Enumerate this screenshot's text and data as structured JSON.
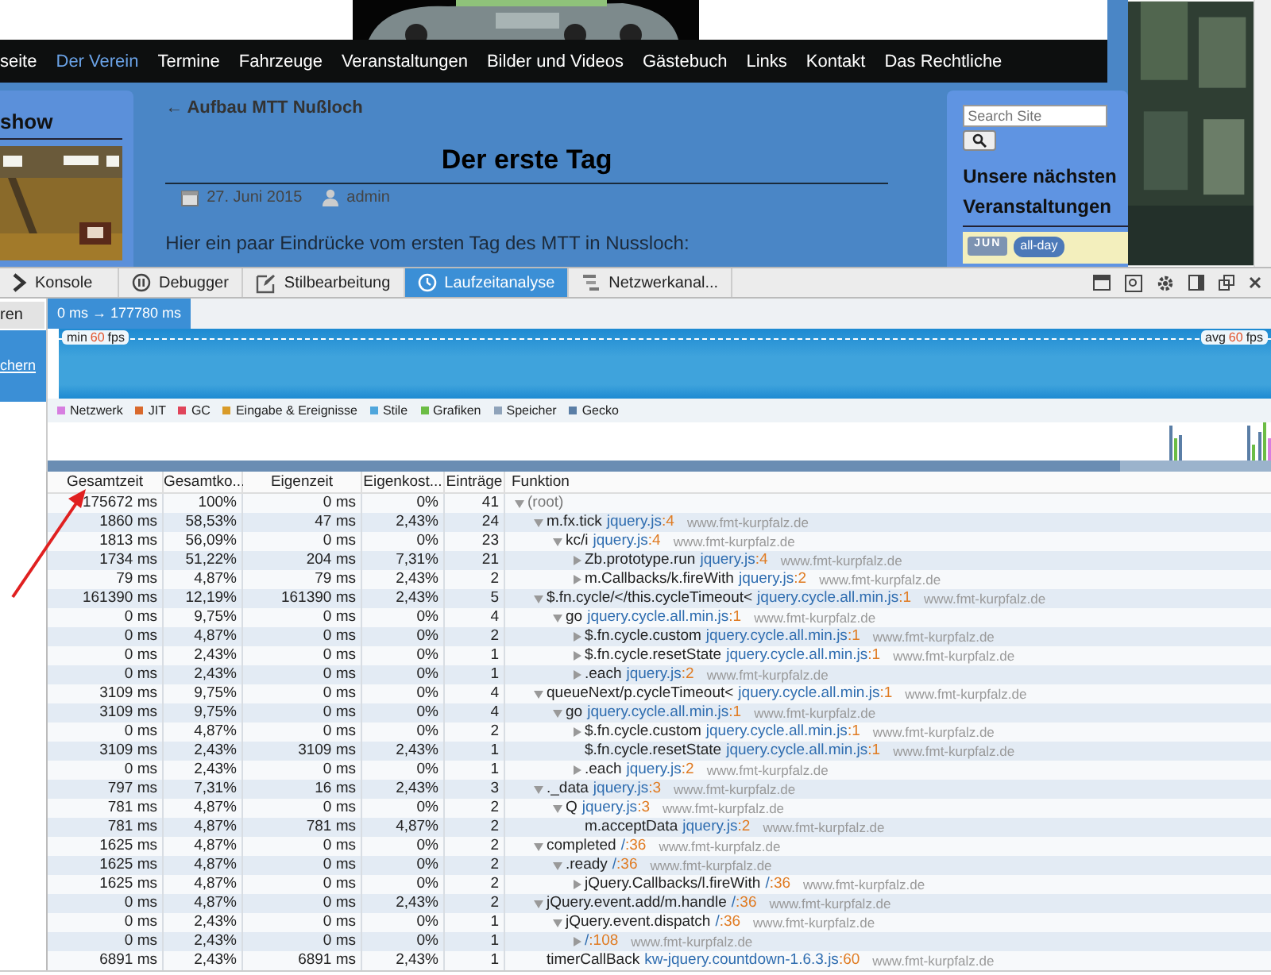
{
  "site": {
    "nav": [
      {
        "label": "seite",
        "selected": false
      },
      {
        "label": "Der Verein",
        "selected": true
      },
      {
        "label": "Termine",
        "selected": false
      },
      {
        "label": "Fahrzeuge",
        "selected": false
      },
      {
        "label": "Veranstaltungen",
        "selected": false
      },
      {
        "label": "Bilder und Videos",
        "selected": false
      },
      {
        "label": "Gästebuch",
        "selected": false
      },
      {
        "label": "Links",
        "selected": false
      },
      {
        "label": "Kontakt",
        "selected": false
      },
      {
        "label": "Das Rechtliche",
        "selected": false
      }
    ],
    "slideshow_heading": "show",
    "back_link": "← Aufbau MTT Nußloch",
    "post_title": "Der erste Tag",
    "date": "27. Juni 2015",
    "author": "admin",
    "excerpt": "Hier ein paar Eindrücke vom ersten Tag des MTT in Nussloch:",
    "search": {
      "placeholder": "Search Site"
    },
    "events_heading": "Unsere nächsten Veranstaltungen",
    "event_month": "JUN",
    "event_badge": "all-day"
  },
  "devtools": {
    "tabs": [
      {
        "label": "Konsole",
        "selected": false
      },
      {
        "label": "Debugger",
        "selected": false
      },
      {
        "label": "Stilbearbeitung",
        "selected": false
      },
      {
        "label": "Laufzeitanalyse",
        "selected": true
      },
      {
        "label": "Netzwerkanal...",
        "selected": false
      }
    ],
    "sidebar_button": "ren",
    "sidebar_link": "chern",
    "time_range": "0 ms → 177780 ms",
    "fps_min": {
      "label": "min",
      "value": "60",
      "unit": "fps"
    },
    "fps_avg": {
      "label": "avg",
      "value": "60",
      "unit": "fps"
    },
    "legend": [
      {
        "label": "Netzwerk",
        "color": "#d77ee0"
      },
      {
        "label": "JIT",
        "color": "#d9692c"
      },
      {
        "label": "GC",
        "color": "#e0445a"
      },
      {
        "label": "Eingabe & Ereignisse",
        "color": "#d99b28"
      },
      {
        "label": "Stile",
        "color": "#4fa6dc"
      },
      {
        "label": "Grafiken",
        "color": "#6cbd45"
      },
      {
        "label": "Speicher",
        "color": "#8fa3ba"
      },
      {
        "label": "Gecko",
        "color": "#5a7ea6"
      }
    ]
  },
  "table": {
    "columns": [
      "Gesamtzeit",
      "Gesamtko...",
      "Eigenzeit",
      "Eigenkost...",
      "Einträge",
      "Funktion"
    ],
    "rows": [
      {
        "total": "175672 ms",
        "total_pct": "100%",
        "self": "0 ms",
        "self_pct": "0%",
        "entries": "41",
        "function": "(root)",
        "kind": "node",
        "expanded": true,
        "children": [
          {
            "total": "1860 ms",
            "total_pct": "58,53%",
            "self": "47 ms",
            "self_pct": "2,43%",
            "entries": "24",
            "function": "m.fx.tick",
            "file": "jquery.js",
            "line": ":4",
            "host": "www.fmt-kurpfalz.de",
            "kind": "node",
            "expanded": true,
            "children": [
              {
                "total": "1813 ms",
                "total_pct": "56,09%",
                "self": "0 ms",
                "self_pct": "0%",
                "entries": "23",
                "function": "kc/i",
                "file": "jquery.js",
                "line": ":4",
                "host": "www.fmt-kurpfalz.de",
                "kind": "node",
                "expanded": true,
                "children": [
                  {
                    "total": "1734 ms",
                    "total_pct": "51,22%",
                    "self": "204 ms",
                    "self_pct": "7,31%",
                    "entries": "21",
                    "function": "Zb.prototype.run",
                    "file": "jquery.js",
                    "line": ":4",
                    "host": "www.fmt-kurpfalz.de",
                    "kind": "node",
                    "expanded": false
                  },
                  {
                    "total": "79 ms",
                    "total_pct": "4,87%",
                    "self": "79 ms",
                    "self_pct": "2,43%",
                    "entries": "2",
                    "function": "m.Callbacks/k.fireWith",
                    "file": "jquery.js",
                    "line": ":2",
                    "host": "www.fmt-kurpfalz.de",
                    "kind": "node",
                    "expanded": false
                  }
                ]
              }
            ]
          },
          {
            "total": "161390 ms",
            "total_pct": "12,19%",
            "self": "161390 ms",
            "self_pct": "2,43%",
            "entries": "5",
            "function": "$.fn.cycle/</this.cycleTimeout<",
            "file": "jquery.cycle.all.min.js",
            "line": ":1",
            "host": "www.fmt-kurpfalz.de",
            "kind": "node",
            "expanded": true,
            "children": [
              {
                "total": "0 ms",
                "total_pct": "9,75%",
                "self": "0 ms",
                "self_pct": "0%",
                "entries": "4",
                "function": "go",
                "file": "jquery.cycle.all.min.js",
                "line": ":1",
                "host": "www.fmt-kurpfalz.de",
                "kind": "node",
                "expanded": true,
                "children": [
                  {
                    "total": "0 ms",
                    "total_pct": "4,87%",
                    "self": "0 ms",
                    "self_pct": "0%",
                    "entries": "2",
                    "function": "$.fn.cycle.custom",
                    "file": "jquery.cycle.all.min.js",
                    "line": ":1",
                    "host": "www.fmt-kurpfalz.de",
                    "kind": "node",
                    "expanded": false
                  },
                  {
                    "total": "0 ms",
                    "total_pct": "2,43%",
                    "self": "0 ms",
                    "self_pct": "0%",
                    "entries": "1",
                    "function": "$.fn.cycle.resetState",
                    "file": "jquery.cycle.all.min.js",
                    "line": ":1",
                    "host": "www.fmt-kurpfalz.de",
                    "kind": "node",
                    "expanded": false
                  },
                  {
                    "total": "0 ms",
                    "total_pct": "2,43%",
                    "self": "0 ms",
                    "self_pct": "0%",
                    "entries": "1",
                    "function": ".each",
                    "file": "jquery.js",
                    "line": ":2",
                    "host": "www.fmt-kurpfalz.de",
                    "kind": "node",
                    "expanded": false
                  }
                ]
              }
            ]
          },
          {
            "total": "3109 ms",
            "total_pct": "9,75%",
            "self": "0 ms",
            "self_pct": "0%",
            "entries": "4",
            "function": "queueNext/p.cycleTimeout<",
            "file": "jquery.cycle.all.min.js",
            "line": ":1",
            "host": "www.fmt-kurpfalz.de",
            "kind": "node",
            "expanded": true,
            "children": [
              {
                "total": "3109 ms",
                "total_pct": "9,75%",
                "self": "0 ms",
                "self_pct": "0%",
                "entries": "4",
                "function": "go",
                "file": "jquery.cycle.all.min.js",
                "line": ":1",
                "host": "www.fmt-kurpfalz.de",
                "kind": "node",
                "expanded": true,
                "children": [
                  {
                    "total": "0 ms",
                    "total_pct": "4,87%",
                    "self": "0 ms",
                    "self_pct": "0%",
                    "entries": "2",
                    "function": "$.fn.cycle.custom",
                    "file": "jquery.cycle.all.min.js",
                    "line": ":1",
                    "host": "www.fmt-kurpfalz.de",
                    "kind": "node",
                    "expanded": false
                  },
                  {
                    "total": "3109 ms",
                    "total_pct": "2,43%",
                    "self": "3109 ms",
                    "self_pct": "2,43%",
                    "entries": "1",
                    "function": "$.fn.cycle.resetState",
                    "file": "jquery.cycle.all.min.js",
                    "line": ":1",
                    "host": "www.fmt-kurpfalz.de",
                    "kind": "leaf"
                  },
                  {
                    "total": "0 ms",
                    "total_pct": "2,43%",
                    "self": "0 ms",
                    "self_pct": "0%",
                    "entries": "1",
                    "function": ".each",
                    "file": "jquery.js",
                    "line": ":2",
                    "host": "www.fmt-kurpfalz.de",
                    "kind": "node",
                    "expanded": false
                  }
                ]
              }
            ]
          },
          {
            "total": "797 ms",
            "total_pct": "7,31%",
            "self": "16 ms",
            "self_pct": "2,43%",
            "entries": "3",
            "function": "._data",
            "file": "jquery.js",
            "line": ":3",
            "host": "www.fmt-kurpfalz.de",
            "kind": "node",
            "expanded": true,
            "children": [
              {
                "total": "781 ms",
                "total_pct": "4,87%",
                "self": "0 ms",
                "self_pct": "0%",
                "entries": "2",
                "function": "Q",
                "file": "jquery.js",
                "line": ":3",
                "host": "www.fmt-kurpfalz.de",
                "kind": "node",
                "expanded": true,
                "children": [
                  {
                    "total": "781 ms",
                    "total_pct": "4,87%",
                    "self": "781 ms",
                    "self_pct": "4,87%",
                    "entries": "2",
                    "function": "m.acceptData",
                    "file": "jquery.js",
                    "line": ":2",
                    "host": "www.fmt-kurpfalz.de",
                    "kind": "leaf"
                  }
                ]
              }
            ]
          },
          {
            "total": "1625 ms",
            "total_pct": "4,87%",
            "self": "0 ms",
            "self_pct": "0%",
            "entries": "2",
            "function": "completed",
            "file": "/",
            "line": ":36",
            "host": "www.fmt-kurpfalz.de",
            "kind": "node",
            "expanded": true,
            "children": [
              {
                "total": "1625 ms",
                "total_pct": "4,87%",
                "self": "0 ms",
                "self_pct": "0%",
                "entries": "2",
                "function": ".ready",
                "file": "/",
                "line": ":36",
                "host": "www.fmt-kurpfalz.de",
                "kind": "node",
                "expanded": true,
                "children": [
                  {
                    "total": "1625 ms",
                    "total_pct": "4,87%",
                    "self": "0 ms",
                    "self_pct": "0%",
                    "entries": "2",
                    "function": "jQuery.Callbacks/l.fireWith",
                    "file": "/",
                    "line": ":36",
                    "host": "www.fmt-kurpfalz.de",
                    "kind": "node",
                    "expanded": false
                  }
                ]
              }
            ]
          },
          {
            "total": "0 ms",
            "total_pct": "4,87%",
            "self": "0 ms",
            "self_pct": "2,43%",
            "entries": "2",
            "function": "jQuery.event.add/m.handle",
            "file": "/",
            "line": ":36",
            "host": "www.fmt-kurpfalz.de",
            "kind": "node",
            "expanded": true,
            "children": [
              {
                "total": "0 ms",
                "total_pct": "2,43%",
                "self": "0 ms",
                "self_pct": "0%",
                "entries": "1",
                "function": "jQuery.event.dispatch",
                "file": "/",
                "line": ":36",
                "host": "www.fmt-kurpfalz.de",
                "kind": "node",
                "expanded": true,
                "children": [
                  {
                    "total": "0 ms",
                    "total_pct": "2,43%",
                    "self": "0 ms",
                    "self_pct": "0%",
                    "entries": "1",
                    "file": "/",
                    "line": ":108",
                    "host": "www.fmt-kurpfalz.de",
                    "kind": "node",
                    "expanded": false
                  }
                ]
              }
            ]
          },
          {
            "total": "6891 ms",
            "total_pct": "2,43%",
            "self": "6891 ms",
            "self_pct": "2,43%",
            "entries": "1",
            "function": "timerCallBack",
            "file": "kw-jquery.countdown-1.6.3.js",
            "line": ":60",
            "host": "www.fmt-kurpfalz.de",
            "kind": "leaf"
          }
        ]
      }
    ]
  }
}
